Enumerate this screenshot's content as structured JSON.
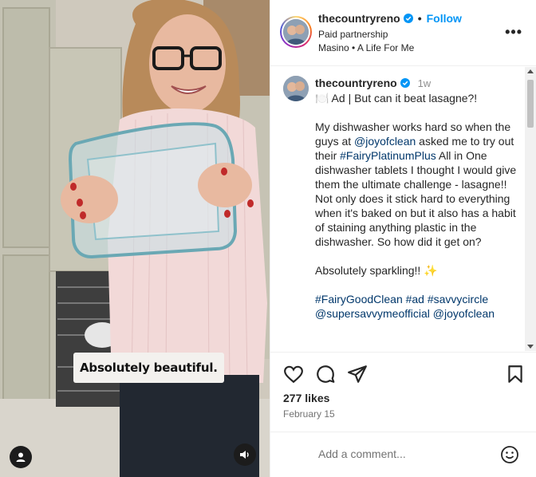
{
  "media": {
    "caption_overlay": "Absolutely beautiful."
  },
  "header": {
    "username": "thecountryreno",
    "follow_label": "Follow",
    "dot": "•",
    "subtitle": "Paid partnership",
    "music": "Masino • A Life For Me",
    "more_label": "•••"
  },
  "caption": {
    "username": "thecountryreno",
    "time": "1w",
    "line1": "🍽️ Ad | But can it beat lasagne?!",
    "p1_a": "My dishwasher works hard so when the guys at ",
    "p1_mention": "@joyofclean",
    "p1_b": " asked me to try out their ",
    "p1_hashtag": "#FairyPlatinumPlus",
    "p1_c": " All in One dishwasher tablets I thought I would give them the ultimate challenge - lasagne!! Not only does it stick hard to everything when it's baked on but it also has a habit of staining anything plastic in the dishwasher. So how did it get on?",
    "p2": "Absolutely sparkling!! ✨",
    "tags_1": "#FairyGoodClean #ad #savvycircle",
    "tags_2": "@supersavvymeofficial @joyofclean"
  },
  "footer": {
    "likes": "277 likes",
    "date": "February 15",
    "comment_placeholder": "Add a comment..."
  },
  "colors": {
    "accent": "#0095f6",
    "link": "#00376b",
    "text": "#262626",
    "muted": "#737373"
  },
  "icons": [
    "heart-icon",
    "comment-icon",
    "share-icon",
    "bookmark-icon",
    "emoji-icon",
    "more-icon",
    "verified-icon",
    "user-tag-icon",
    "sound-icon"
  ]
}
